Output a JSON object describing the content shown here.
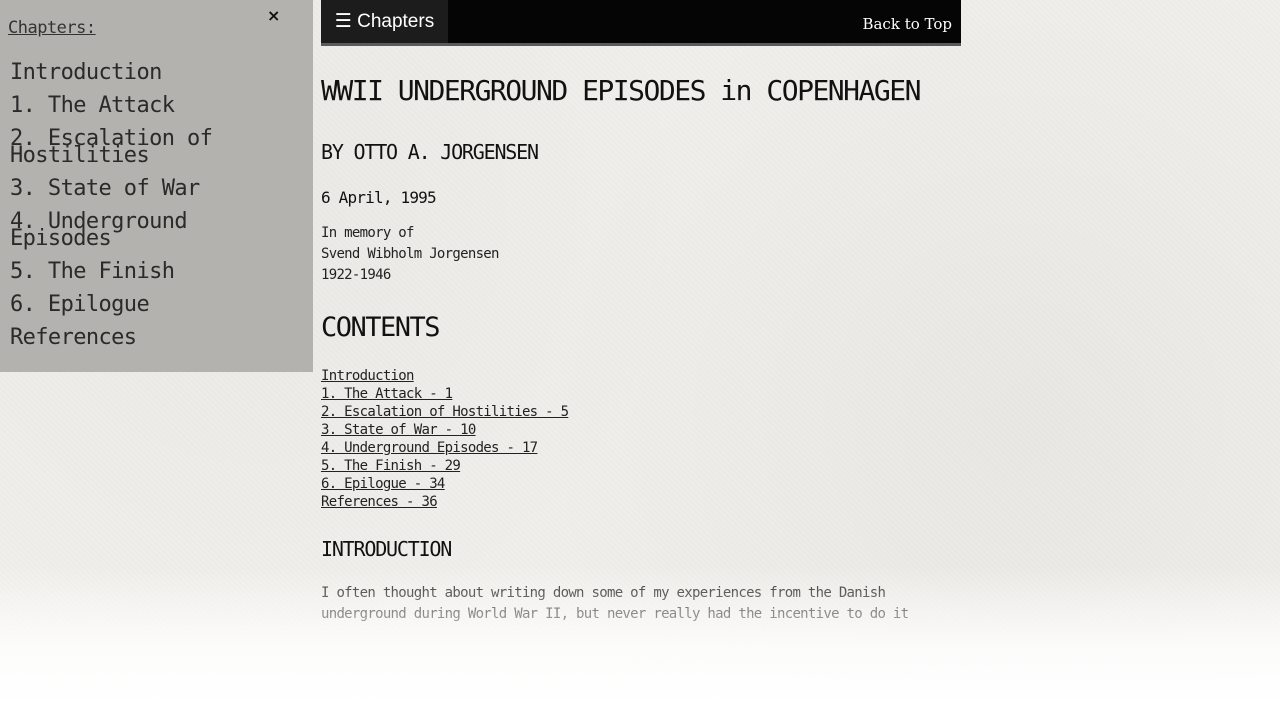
{
  "sidebar": {
    "close_label": "×",
    "heading": "Chapters:",
    "items": [
      {
        "label": "Introduction"
      },
      {
        "label": "1. The Attack"
      },
      {
        "label": "2. Escalation of Hostilities"
      },
      {
        "label": "3. State of War"
      },
      {
        "label": "4. Underground Episodes"
      },
      {
        "label": "5. The Finish"
      },
      {
        "label": "6. Epilogue"
      },
      {
        "label": "References"
      }
    ]
  },
  "topbar": {
    "chapters_label": "☰ Chapters",
    "back_to_top": "Back to Top"
  },
  "main": {
    "title": "WWII UNDERGROUND EPISODES in COPENHAGEN",
    "author": "BY OTTO A. JORGENSEN",
    "date": "6 April, 1995",
    "memory": {
      "line1": "In memory of",
      "line2": "Svend Wibholm Jorgensen",
      "line3": "1922-1946"
    },
    "contents_heading": "CONTENTS",
    "toc": [
      {
        "label": "Introduction"
      },
      {
        "label": "1. The Attack - 1"
      },
      {
        "label": "2. Escalation of Hostilities - 5"
      },
      {
        "label": "3. State of War - 10"
      },
      {
        "label": "4. Underground Episodes - 17"
      },
      {
        "label": "5. The Finish - 29"
      },
      {
        "label": "6. Epilogue - 34"
      },
      {
        "label": "References - 36"
      }
    ],
    "intro_heading": "INTRODUCTION",
    "intro_text": "I often thought about writing down some of my experiences from the Danish underground during World War II, but never really had the incentive to do it"
  }
}
